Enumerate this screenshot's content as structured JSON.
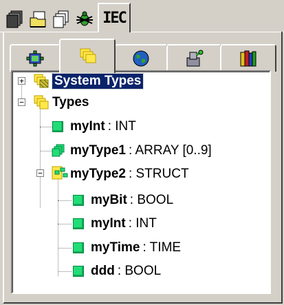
{
  "top_tabs": [
    {
      "icon": "pou-list-icon"
    },
    {
      "icon": "data-types-folder-icon"
    },
    {
      "icon": "visualizations-icon"
    },
    {
      "icon": "resources-bug-icon"
    },
    {
      "icon": "iec-types-icon",
      "label": "IEC",
      "active": true
    }
  ],
  "sub_tabs": [
    {
      "icon": "network-variables-icon"
    },
    {
      "icon": "types-stack-icon",
      "active": true
    },
    {
      "icon": "globe-icon"
    },
    {
      "icon": "function-blocks-icon"
    },
    {
      "icon": "library-books-icon"
    }
  ],
  "tree": {
    "system_types": {
      "name": "System Types",
      "expanded": false,
      "selected": true
    },
    "types": {
      "name": "Types",
      "expanded": true,
      "items": [
        {
          "name": "myInt",
          "type": ": INT"
        },
        {
          "name": "myType1",
          "type": ": ARRAY [0..9]"
        },
        {
          "name": "myType2",
          "type": ": STRUCT",
          "expanded": true,
          "children": [
            {
              "name": "myBit",
              "type": ": BOOL"
            },
            {
              "name": "myInt",
              "type": ": INT"
            },
            {
              "name": "myTime",
              "type": ": TIME"
            },
            {
              "name": "ddd",
              "type": ": BOOL"
            }
          ]
        }
      ]
    }
  },
  "colors": {
    "selection": "#0a246a",
    "leaf_icon": "#22dd77",
    "folder_icon": "#ffe84a",
    "window_bg": "#d4d0c8"
  }
}
